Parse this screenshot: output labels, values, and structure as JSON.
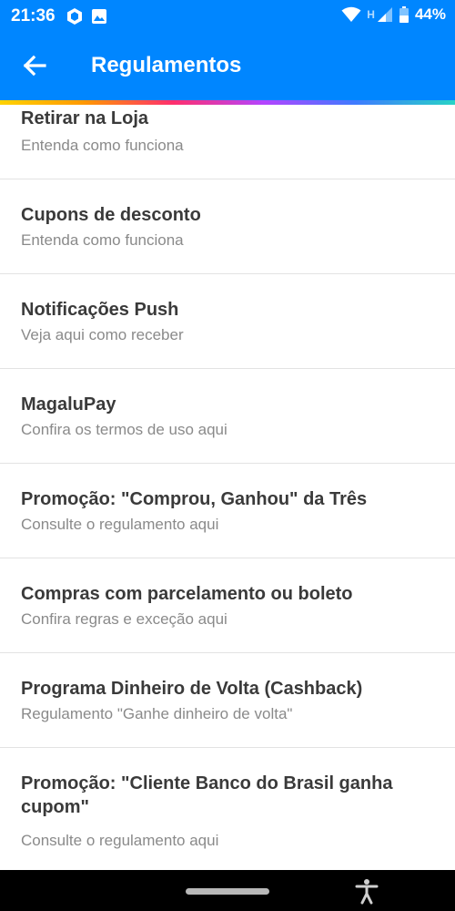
{
  "status_bar": {
    "time": "21:36",
    "battery": "44%",
    "network_letter": "H"
  },
  "header": {
    "title": "Regulamentos",
    "back_icon": "arrow-back-icon"
  },
  "colors": {
    "primary": "#0086ff",
    "title_text": "#3a3a3a",
    "subtitle_text": "#8a8a8a"
  },
  "items": [
    {
      "title": "Retirar na Loja",
      "subtitle": "Entenda como funciona"
    },
    {
      "title": "Cupons de desconto",
      "subtitle": "Entenda como funciona"
    },
    {
      "title": "Notificações Push",
      "subtitle": "Veja aqui como receber"
    },
    {
      "title": "MagaluPay",
      "subtitle": "Confira os termos de uso aqui"
    },
    {
      "title": "Promoção: \"Comprou, Ganhou\" da Três",
      "subtitle": "Consulte o regulamento aqui"
    },
    {
      "title": "Compras com parcelamento ou boleto",
      "subtitle": "Confira regras e exceção aqui"
    },
    {
      "title": "Programa Dinheiro de Volta (Cashback)",
      "subtitle": "Regulamento \"Ganhe dinheiro de volta\""
    },
    {
      "title": "Promoção: \"Cliente Banco do Brasil ganha cupom\"",
      "subtitle": "Consulte o regulamento aqui"
    }
  ]
}
